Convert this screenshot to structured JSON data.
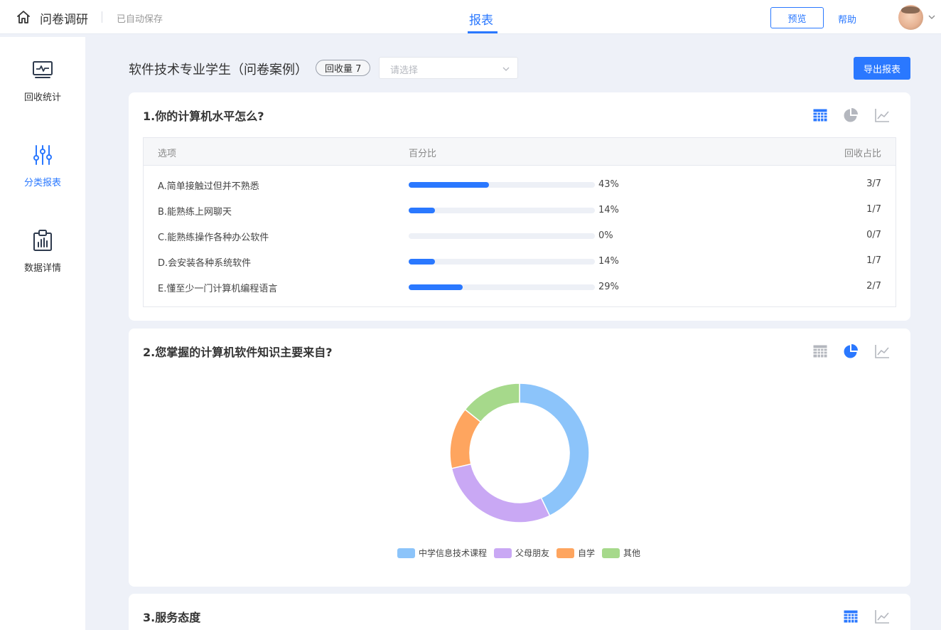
{
  "header": {
    "app_title": "问卷调研",
    "autosave": "已自动保存",
    "active_tab": "报表",
    "preview_label": "预览",
    "help_label": "帮助"
  },
  "sidebar": {
    "items": [
      {
        "label": "回收统计",
        "icon": "monitor-pulse-icon"
      },
      {
        "label": "分类报表",
        "icon": "sliders-icon"
      },
      {
        "label": "数据详情",
        "icon": "clipboard-chart-icon"
      }
    ],
    "active_index": 1
  },
  "survey": {
    "title": "软件技术专业学生（问卷案例）",
    "count_badge": "回收量 7",
    "select_placeholder": "请选择",
    "export_label": "导出报表"
  },
  "questions": [
    {
      "title": "1.你的计算机水平怎么?",
      "view": "table",
      "columns": [
        "选项",
        "百分比",
        "回收占比"
      ],
      "rows": [
        {
          "option": "A.简单接触过但并不熟悉",
          "percent": 43,
          "percent_label": "43%",
          "ratio": "3/7"
        },
        {
          "option": "B.能熟练上网聊天",
          "percent": 14,
          "percent_label": "14%",
          "ratio": "1/7"
        },
        {
          "option": "C.能熟练操作各种办公软件",
          "percent": 0,
          "percent_label": "0%",
          "ratio": "0/7"
        },
        {
          "option": "D.会安装各种系统软件",
          "percent": 14,
          "percent_label": "14%",
          "ratio": "1/7"
        },
        {
          "option": "E.懂至少一门计算机编程语言",
          "percent": 29,
          "percent_label": "29%",
          "ratio": "2/7"
        }
      ]
    },
    {
      "title": "2.您掌握的计算机软件知识主要来自?",
      "view": "pie"
    },
    {
      "title": "3.服务态度",
      "view": "table"
    }
  ],
  "colors": {
    "accent": "#2a78ff",
    "icon_inactive": "#b4b7be"
  },
  "chart_data": {
    "type": "pie",
    "style": "donut",
    "categories": [
      "中学信息技术课程",
      "父母朋友",
      "自学",
      "其他"
    ],
    "values": [
      3,
      2,
      1,
      1
    ],
    "colors": [
      "#8cc4fa",
      "#c9a8f4",
      "#fea55f",
      "#a6d98b"
    ],
    "legend": "bottom"
  }
}
